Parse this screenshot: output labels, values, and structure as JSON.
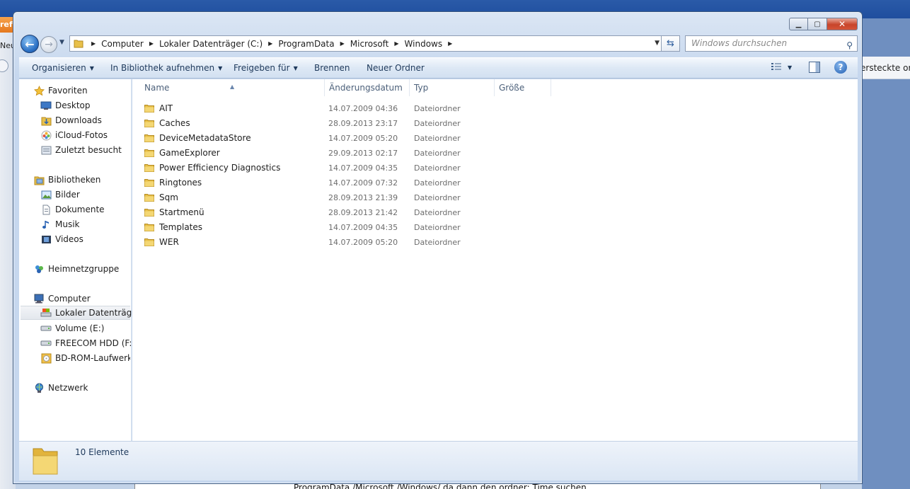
{
  "background": {
    "orange_button_text": "refe",
    "left_label": "Neu",
    "right_bar_text": "ersteckte ordn",
    "bottom_text": "ProgramData /Microsoft /Windows/ da dann den ordner: Time  suchen"
  },
  "window": {
    "caption_buttons": [
      "minimize",
      "maximize",
      "close"
    ]
  },
  "address_bar": {
    "breadcrumbs": [
      "Computer",
      "Lokaler Datenträger (C:)",
      "ProgramData",
      "Microsoft",
      "Windows"
    ]
  },
  "search": {
    "placeholder": "Windows durchsuchen"
  },
  "toolbar": {
    "organize": "Organisieren",
    "include_library": "In Bibliothek aufnehmen",
    "share": "Freigeben für",
    "burn": "Brennen",
    "new_folder": "Neuer Ordner"
  },
  "sidebar": {
    "favorites_header": "Favoriten",
    "favorites": [
      "Desktop",
      "Downloads",
      "iCloud-Fotos",
      "Zuletzt besucht"
    ],
    "libraries_header": "Bibliotheken",
    "libraries": [
      "Bilder",
      "Dokumente",
      "Musik",
      "Videos"
    ],
    "homegroup": "Heimnetzgruppe",
    "computer_header": "Computer",
    "drives": [
      "Lokaler Datenträger",
      "Volume (E:)",
      "FREECOM HDD (F:)",
      "BD-ROM-Laufwerk ("
    ],
    "network": "Netzwerk"
  },
  "columns": {
    "name": "Name",
    "date": "Änderungsdatum",
    "type": "Typ",
    "size": "Größe"
  },
  "files": [
    {
      "name": "AIT",
      "date": "14.07.2009 04:36",
      "type": "Dateiordner"
    },
    {
      "name": "Caches",
      "date": "28.09.2013 23:17",
      "type": "Dateiordner"
    },
    {
      "name": "DeviceMetadataStore",
      "date": "14.07.2009 05:20",
      "type": "Dateiordner"
    },
    {
      "name": "GameExplorer",
      "date": "29.09.2013 02:17",
      "type": "Dateiordner"
    },
    {
      "name": "Power Efficiency Diagnostics",
      "date": "14.07.2009 04:35",
      "type": "Dateiordner"
    },
    {
      "name": "Ringtones",
      "date": "14.07.2009 07:32",
      "type": "Dateiordner"
    },
    {
      "name": "Sqm",
      "date": "28.09.2013 21:39",
      "type": "Dateiordner"
    },
    {
      "name": "Startmenü",
      "date": "28.09.2013 21:42",
      "type": "Dateiordner"
    },
    {
      "name": "Templates",
      "date": "14.07.2009 04:35",
      "type": "Dateiordner"
    },
    {
      "name": "WER",
      "date": "14.07.2009 05:20",
      "type": "Dateiordner"
    }
  ],
  "status": {
    "item_count": "10 Elemente"
  },
  "colors": {
    "accent": "#1e395b",
    "folder": "#e8c04a",
    "selection": "#e3e7ed"
  }
}
